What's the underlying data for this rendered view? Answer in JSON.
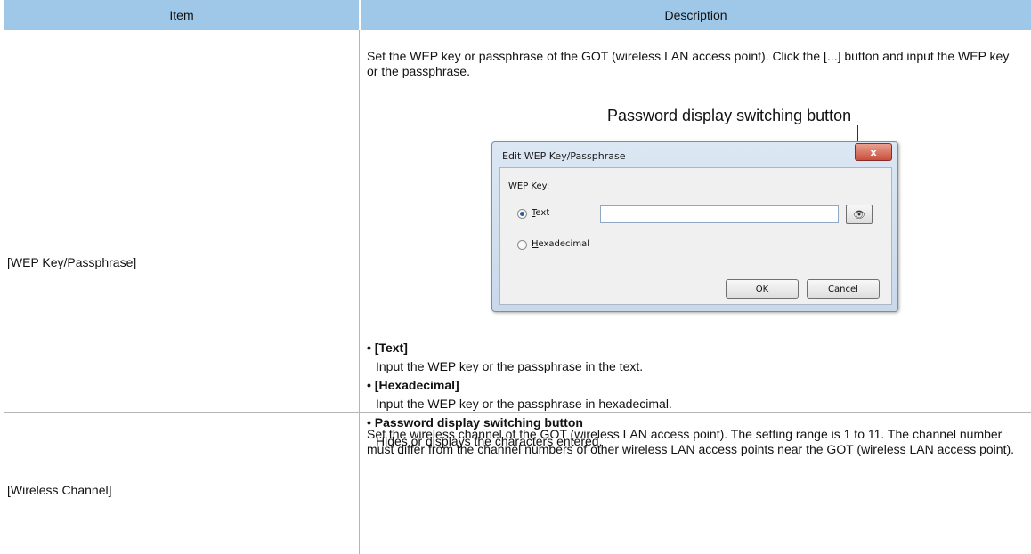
{
  "table": {
    "header": {
      "item": "Item",
      "description": "Description"
    },
    "rows": [
      {
        "item": "[WEP Key/Passphrase]",
        "intro": "Set the WEP key or passphrase of the GOT (wireless LAN access point). Click the [...] button and input the WEP key or the passphrase.",
        "callout": "Password display switching button",
        "dialog": {
          "title": "Edit WEP Key/Passphrase",
          "close_label": "x",
          "wep_key_label": "WEP Key:",
          "text_option": {
            "accel": "T",
            "rest": "ext",
            "selected": true
          },
          "hex_option": {
            "accel": "H",
            "rest": "exadecimal",
            "selected": false
          },
          "text_value": "",
          "eye_glyph": "👁",
          "ok_label": "OK",
          "cancel_label": "Cancel"
        },
        "bullets": [
          {
            "title": "• [Text]",
            "text": "Input the WEP key or the passphrase in the text."
          },
          {
            "title": "• [Hexadecimal]",
            "text": "Input the WEP key or the passphrase in hexadecimal."
          },
          {
            "title": "• Password display switching button",
            "text": "Hides or displays the characters entered."
          }
        ]
      },
      {
        "item": "[Wireless Channel]",
        "description": "Set the wireless channel of the GOT (wireless LAN access point). The setting range is 1 to 11. The channel number must differ from the channel numbers of other wireless LAN access points near the GOT (wireless LAN access point)."
      }
    ]
  },
  "colors": {
    "header_bg": "#9fc7e8",
    "grid_line": "#b5b5b5"
  }
}
